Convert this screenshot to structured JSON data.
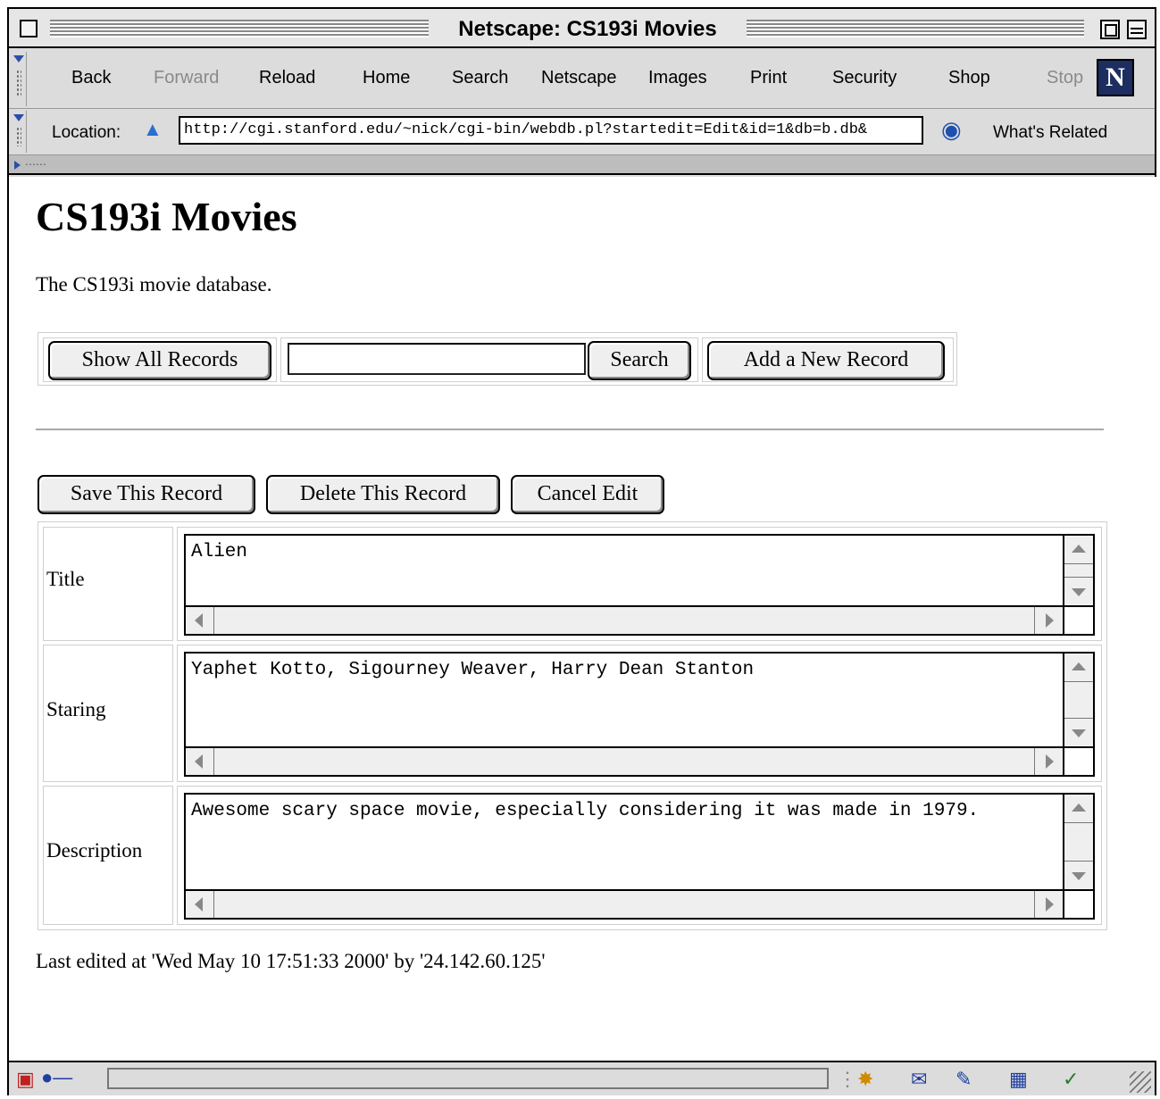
{
  "window": {
    "title": "Netscape: CS193i Movies"
  },
  "toolbar": {
    "back": "Back",
    "forward": "Forward",
    "reload": "Reload",
    "home": "Home",
    "search": "Search",
    "netscape": "Netscape",
    "images": "Images",
    "print": "Print",
    "security": "Security",
    "shop": "Shop",
    "stop": "Stop",
    "logo": "N"
  },
  "location": {
    "label": "Location:",
    "url": "http://cgi.stanford.edu/~nick/cgi-bin/webdb.pl?startedit=Edit&id=1&db=b.db&",
    "related": "What's Related"
  },
  "page": {
    "title": "CS193i Movies",
    "description": "The CS193i movie database.",
    "show_all_label": "Show All Records",
    "search_value": "",
    "search_label": "Search",
    "add_label": "Add a New Record",
    "save_label": "Save This Record",
    "delete_label": "Delete This Record",
    "cancel_label": "Cancel Edit",
    "fields": [
      {
        "label": "Title",
        "value": "Alien"
      },
      {
        "label": "Staring",
        "value": "Yaphet Kotto, Sigourney Weaver, Harry Dean Stanton"
      },
      {
        "label": "Description",
        "value": "Awesome scary space movie, especially considering it was made in 1979."
      }
    ],
    "last_edited": "Last edited at 'Wed May 10 17:51:33 2000' by '24.142.60.125'"
  }
}
